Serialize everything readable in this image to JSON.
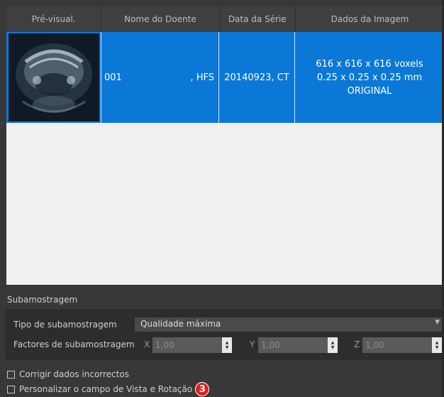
{
  "table": {
    "headers": [
      "Pré-visual.",
      "Nome do Doente",
      "Data da Série",
      "Dados da Imagem"
    ],
    "rows": [
      {
        "patient_id": "001",
        "patient_suffix": ", HFS",
        "series_date": "20140923, CT",
        "image_dims": "616 x 616 x 616 voxels",
        "image_spacing": "0.25 x 0.25 x 0.25 mm",
        "image_type": "ORIGINAL"
      }
    ]
  },
  "subsampling": {
    "title": "Subamostragem",
    "type_label": "Tipo de subamostragem",
    "type_value": "Qualidade máxima",
    "factors_label": "Factores de subamostragem",
    "x_label": "X",
    "x_value": "1,00",
    "y_label": "Y",
    "y_value": "1,00",
    "z_label": "Z",
    "z_value": "1,00"
  },
  "options": {
    "fix_data_label": "Corrigir dados incorrectos",
    "custom_fov_label": "Personalizar o campo de Vista e Rotação",
    "badge_number": "3"
  },
  "colors": {
    "selection": "#0b78d8",
    "badge": "#e02020"
  },
  "icons": {
    "spin": "up-down-arrows",
    "combo": "chevron-down"
  }
}
